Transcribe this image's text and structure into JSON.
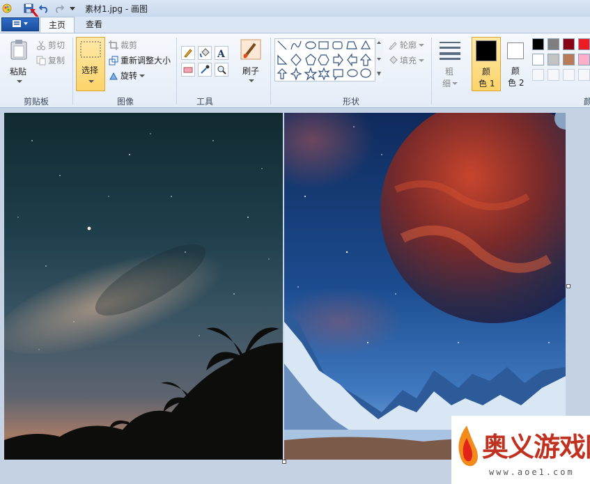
{
  "window": {
    "title": "素材1.jpg - 画图"
  },
  "tabs": [
    {
      "label": "主页"
    },
    {
      "label": "查看"
    }
  ],
  "clipboard": {
    "paste": "粘贴",
    "cut": "剪切",
    "copy": "复制",
    "group": "剪贴板"
  },
  "image": {
    "select": "选择",
    "crop": "裁剪",
    "resize": "重新调整大小",
    "rotate": "旋转",
    "group": "图像"
  },
  "tools": {
    "group": "工具"
  },
  "brushes": {
    "label": "刷子"
  },
  "shapes": {
    "outline": "轮廓",
    "fill": "填充",
    "group": "形状"
  },
  "size": {
    "line1": "粗",
    "line2": "细"
  },
  "color1": {
    "line1": "颜",
    "line2": "色 1"
  },
  "color2": {
    "line1": "颜",
    "line2": "色 2"
  },
  "colors_group": "颜",
  "palette": [
    "#000000",
    "#7f7f7f",
    "#880015",
    "#ed1c24",
    "#ffffff",
    "#c3c3c3",
    "#b97a57",
    "#ffaec9"
  ],
  "watermark": {
    "brand": "奥义游戏网",
    "url": "www.aoe1.com"
  }
}
